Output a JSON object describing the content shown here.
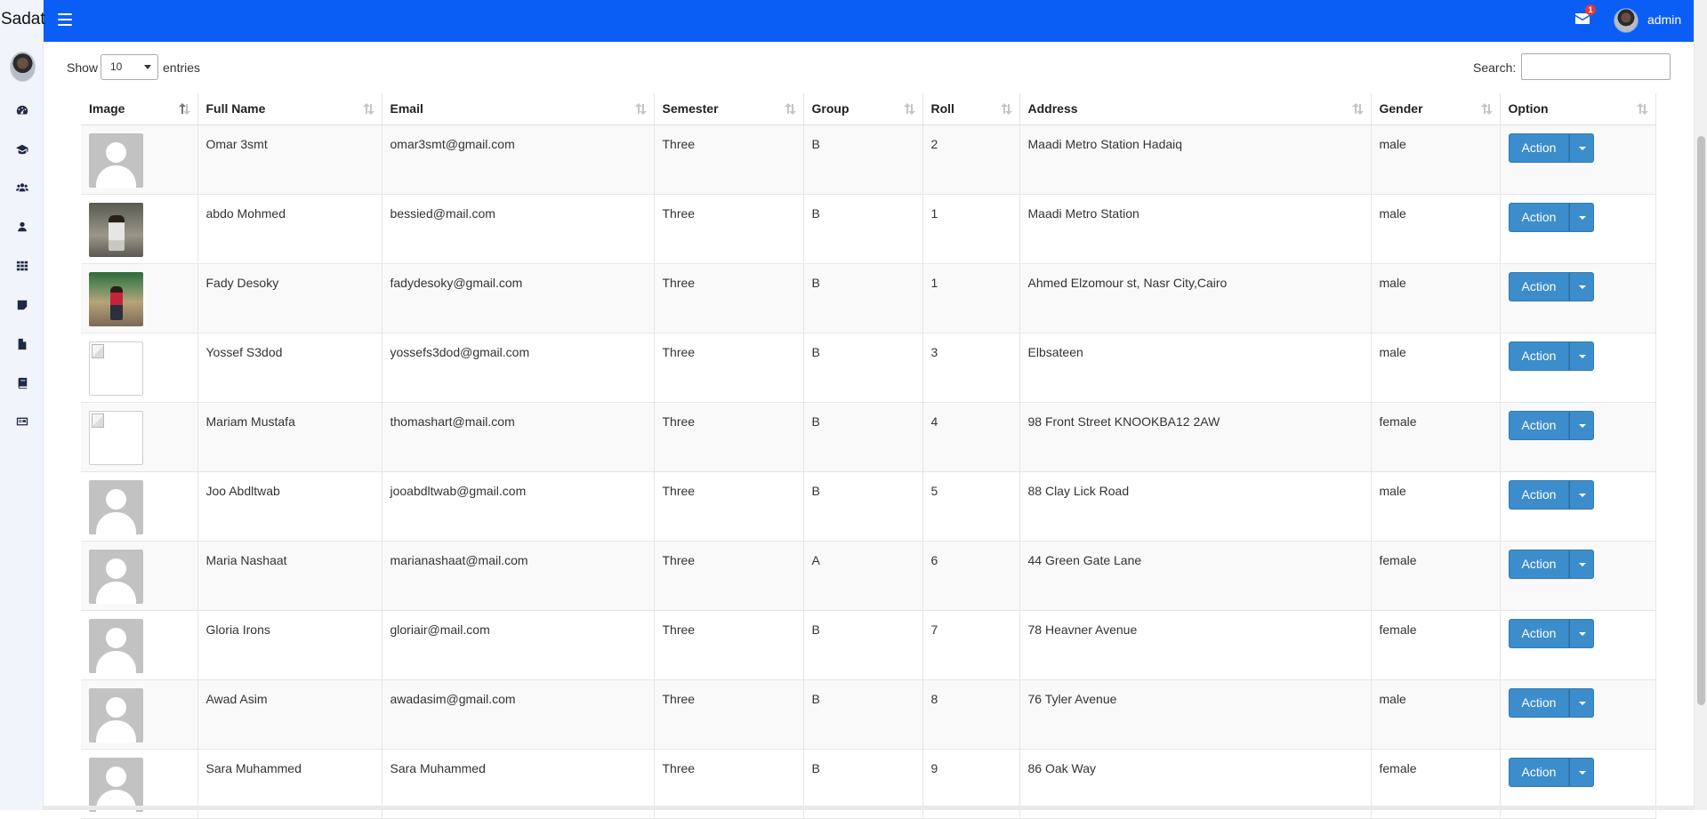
{
  "brand": "Sadat",
  "topbar": {
    "mail_badge": "1",
    "user": "admin"
  },
  "controls": {
    "show_label": "Show",
    "length_value": "10",
    "entries_label": "entries",
    "search_label": "Search:",
    "search_value": ""
  },
  "table": {
    "columns": [
      "Image",
      "Full Name",
      "Email",
      "Semester",
      "Group",
      "Roll",
      "Address",
      "Gender",
      "Option"
    ],
    "action_label": "Action",
    "rows": [
      {
        "image": "default",
        "name": "Omar 3smt",
        "email": "omar3smt@gmail.com",
        "semester": "Three",
        "group": "B",
        "roll": "2",
        "address": "Maadi Metro Station Hadaiq",
        "gender": "male"
      },
      {
        "image": "photo1",
        "name": "abdo Mohmed",
        "email": "bessied@mail.com",
        "semester": "Three",
        "group": "B",
        "roll": "1",
        "address": "Maadi Metro Station",
        "gender": "male"
      },
      {
        "image": "photo2",
        "name": "Fady Desoky",
        "email": "fadydesoky@gmail.com",
        "semester": "Three",
        "group": "B",
        "roll": "1",
        "address": "Ahmed Elzomour st, Nasr City,Cairo",
        "gender": "male"
      },
      {
        "image": "broken",
        "name": "Yossef S3dod",
        "email": "yossefs3dod@gmail.com",
        "semester": "Three",
        "group": "B",
        "roll": "3",
        "address": "Elbsateen",
        "gender": "male"
      },
      {
        "image": "broken",
        "name": "Mariam Mustafa",
        "email": "thomashart@mail.com",
        "semester": "Three",
        "group": "B",
        "roll": "4",
        "address": "98 Front Street KNOOKBA12 2AW",
        "gender": "female"
      },
      {
        "image": "default",
        "name": "Joo Abdltwab",
        "email": "jooabdltwab@gmail.com",
        "semester": "Three",
        "group": "B",
        "roll": "5",
        "address": "88 Clay Lick Road",
        "gender": "male"
      },
      {
        "image": "default",
        "name": "Maria Nashaat",
        "email": "marianashaat@mail.com",
        "semester": "Three",
        "group": "A",
        "roll": "6",
        "address": "44 Green Gate Lane",
        "gender": "female"
      },
      {
        "image": "default",
        "name": "Gloria Irons",
        "email": "gloriair@mail.com",
        "semester": "Three",
        "group": "B",
        "roll": "7",
        "address": "78 Heavner Avenue",
        "gender": "female"
      },
      {
        "image": "default",
        "name": "Awad Asim",
        "email": "awadasim@gmail.com",
        "semester": "Three",
        "group": "B",
        "roll": "8",
        "address": "76 Tyler Avenue",
        "gender": "male"
      },
      {
        "image": "default",
        "name": "Sara Muhammed",
        "email": "Sara Muhammed",
        "semester": "Three",
        "group": "B",
        "roll": "9",
        "address": "86 Oak Way",
        "gender": "female"
      }
    ]
  },
  "sidebar_icons": [
    "dashboard-icon",
    "graduation-cap-icon",
    "users-icon",
    "user-icon",
    "grid-icon",
    "note-icon",
    "file-icon",
    "book-icon",
    "id-card-icon"
  ],
  "colors": {
    "topbar": "#0b5ef5",
    "action": "#3c8dcb",
    "sidebar": "#f1f4fb"
  }
}
